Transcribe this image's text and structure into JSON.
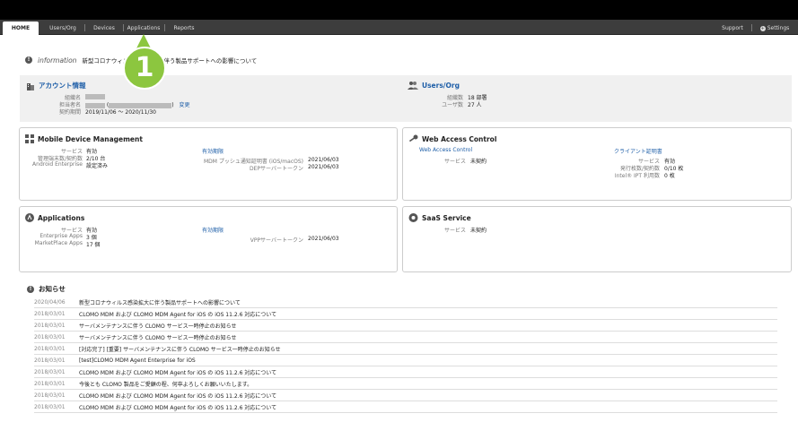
{
  "nav": {
    "tabs": [
      "HOME",
      "Users/Org",
      "Devices",
      "Applications",
      "Reports"
    ],
    "right": {
      "support": "Support",
      "settings": "Settings"
    }
  },
  "callout_number": "1",
  "info": {
    "label": "information",
    "text": "新型コロナウィルス感染拡大に伴う製品サポートへの影響について"
  },
  "account": {
    "title": "アカウント情報",
    "rows": [
      {
        "label": "組織名",
        "value": ""
      },
      {
        "label": "担当者名",
        "value": ""
      },
      {
        "label": "契約期間",
        "value": "2019/11/06 〜 2020/11/30"
      }
    ],
    "change_link": "変更"
  },
  "users_org": {
    "title": "Users/Org",
    "rows": [
      {
        "label": "組織数",
        "value": "18 部署"
      },
      {
        "label": "ユーザ数",
        "value": "27 人"
      }
    ]
  },
  "mdm": {
    "title": "Mobile Device Management",
    "rows": [
      {
        "label": "サービス",
        "value": "有効"
      },
      {
        "label": "管理端末数/契約数",
        "value": "2/10 台"
      },
      {
        "label": "Android Enterprise",
        "value": "設定済み"
      }
    ],
    "expiry_title": "有効期限",
    "expiry_rows": [
      {
        "label": "MDM プッシュ通知証明書 (iOS/macOS)",
        "value": "2021/06/03"
      },
      {
        "label": "DEPサーバートークン",
        "value": "2021/06/03"
      }
    ]
  },
  "wac": {
    "title": "Web Access Control",
    "sub_left": "Web Access Control",
    "rows": [
      {
        "label": "サービス",
        "value": "未契約"
      }
    ],
    "sub_right": "クライアント証明書",
    "cert_rows": [
      {
        "label": "サービス",
        "value": "有効"
      },
      {
        "label": "発行枚数/契約数",
        "value": "0/10 枚"
      },
      {
        "label": "Intel® IPT 利用数",
        "value": "0 枚"
      }
    ]
  },
  "apps": {
    "title": "Applications",
    "rows": [
      {
        "label": "サービス",
        "value": "有効"
      },
      {
        "label": "Enterprise Apps",
        "value": "3 個"
      },
      {
        "label": "MarketPlace Apps",
        "value": "17 個"
      }
    ],
    "expiry_title": "有効期限",
    "expiry_rows": [
      {
        "label": "VPPサーバートークン",
        "value": "2021/06/03"
      }
    ]
  },
  "saas": {
    "title": "SaaS Service",
    "rows": [
      {
        "label": "サービス",
        "value": "未契約"
      }
    ]
  },
  "news": {
    "title": "お知らせ",
    "items": [
      {
        "date": "2020/04/06",
        "text": "新型コロナウィルス感染拡大に伴う製品サポートへの影響について"
      },
      {
        "date": "2018/03/01",
        "text": "CLOMO MDM および CLOMO MDM Agent for iOS の iOS 11.2.6 対応について"
      },
      {
        "date": "2018/03/01",
        "text": "サーバメンテナンスに伴う CLOMO サービス一時停止のお知らせ"
      },
      {
        "date": "2018/03/01",
        "text": "サーバメンテナンスに伴う CLOMO サービス一時停止のお知らせ"
      },
      {
        "date": "2018/03/01",
        "text": "[対応完了] [重要] サーバメンテナンスに伴う CLOMO サービス一時停止のお知らせ"
      },
      {
        "date": "2018/03/01",
        "text": "[test]CLOMO MDM Agent Enterprise for iOS"
      },
      {
        "date": "2018/03/01",
        "text": "CLOMO MDM および CLOMO MDM Agent for iOS の iOS 11.2.6 対応について"
      },
      {
        "date": "2018/03/01",
        "text": "今後とも CLOMO 製品をご愛顧の程、何卒よろしくお願いいたします。"
      },
      {
        "date": "2018/03/01",
        "text": "CLOMO MDM および CLOMO MDM Agent for iOS の iOS 11.2.6 対応について"
      },
      {
        "date": "2018/03/01",
        "text": "CLOMO MDM および CLOMO MDM Agent for iOS の iOS 11.2.6 対応について"
      }
    ]
  }
}
